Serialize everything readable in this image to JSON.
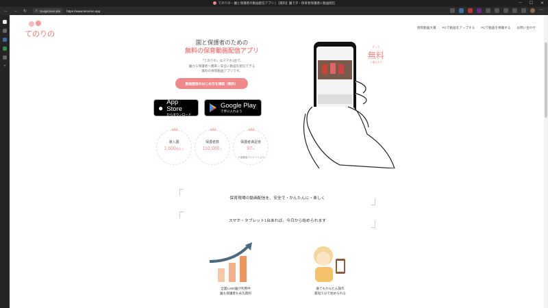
{
  "browser": {
    "tab_title": "てのりの – 園と保護者の動画配信アプリ | 【無料】園で子・保育者保護者に動画配信",
    "security_label": "Suspicious site",
    "url": "https://www.tenorino.app"
  },
  "site": {
    "logo_text": "てのりの",
    "nav": [
      "保育動画大賞",
      "PCで動画をアップする",
      "PCで動画を視聴する",
      "お問い合わせ"
    ]
  },
  "hero": {
    "subtitle": "園と保護者のための",
    "title": "無料の保育動画配信アプリ",
    "desc_lines": [
      "「てのりの」はスマホ1台で、",
      "園から保護者へ簡単・安全に動画を配信できる",
      "無料の保育動画アプリです。"
    ],
    "cta_label": "動画配信のはじめ方を確認（無料）",
    "free_badge": {
      "top": "ずっと",
      "main": "無料",
      "bottom": "で使えます"
    }
  },
  "stores": {
    "apple": {
      "big": "App Store",
      "small": "からダウンロード"
    },
    "google": {
      "big": "Google Play",
      "small": "で手に入れよう"
    }
  },
  "stats": [
    {
      "label": "導入園",
      "value": "1,600",
      "unit": "園以上"
    },
    {
      "label": "保護者数",
      "value": "110,000",
      "unit": "人"
    },
    {
      "label": "保護者満足度",
      "value": "97",
      "unit": "%"
    }
  ],
  "stats_footnote": "※保護者アンケートより",
  "sections": {
    "headline1": "保育現場の動画配信を、安全で・かんたんに・楽しく",
    "headline2": "スマホ・タブレット1台あれば、今日から始められます"
  },
  "features": [
    {
      "line1": "全国1,600園が利用中",
      "line2": "園も保護者も永久無料"
    },
    {
      "line1": "誰でもかんたん操作",
      "line2": "最短５分で始められる"
    }
  ],
  "colors": {
    "accent": "#f08a8a",
    "browser_bg": "#2b2b2b"
  }
}
